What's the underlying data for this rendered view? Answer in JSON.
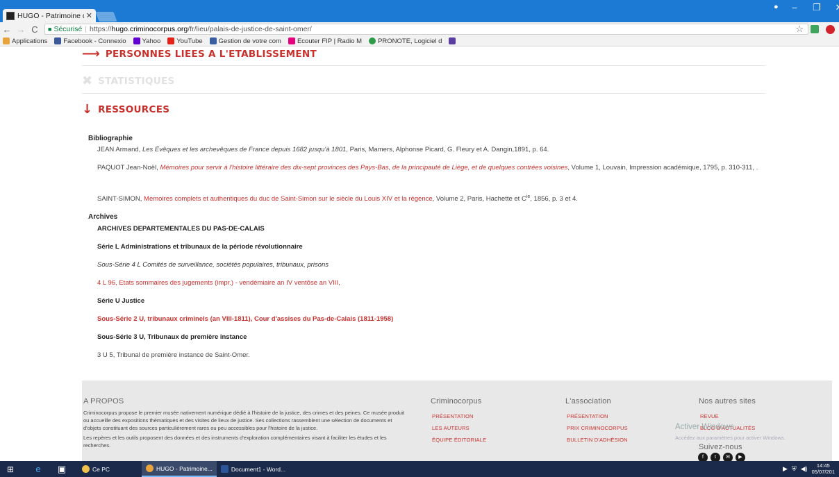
{
  "browser": {
    "tab_title": "HUGO - Patrimoine des...",
    "secure_label": "Sécurisé",
    "url_prefix": "https://",
    "url_domain": "hugo.criminocorpus.org",
    "url_path": "/fr/lieu/palais-de-justice-de-saint-omer/",
    "bookmarks": [
      {
        "label": "Applications",
        "color": "#e8a33d"
      },
      {
        "label": "Facebook - Connexio",
        "color": "#3b5998"
      },
      {
        "label": "Yahoo",
        "color": "#6001d2"
      },
      {
        "label": "YouTube",
        "color": "#e62117"
      },
      {
        "label": "Gestion de votre com",
        "color": "#3a5fa0"
      },
      {
        "label": "Ecouter FIP | Radio M",
        "color": "#e6007e"
      },
      {
        "label": "PRONOTE, Logiciel d",
        "color": "#2d9b4a"
      }
    ]
  },
  "sections": {
    "personnes": "PERSONNES LIEES A L'ETABLISSEMENT",
    "statistiques": "STATISTIQUES",
    "ressources": "RESSOURCES"
  },
  "bibliographie": {
    "title": "Bibliographie",
    "entry1_author": "JEAN Armand, ",
    "entry1_title": "Les Évêques et les archevêques de France depuis 1682 jusqu'à 1801",
    "entry1_rest": ", Paris, Mamers, Alphonse Picard, G. Fleury et A. Dangin,1891, p. 64.",
    "entry2_author": "PAQUOT Jean-Noël, ",
    "entry2_title": "Mémoires pour servir à l'histoire littéraire des dix-sept provinces des Pays-Bas, de la principauté de Liège, et de quelques contrées voisines",
    "entry2_rest": ", Volume 1, Louvain, Impression académique, 1795, p. 310-311, .",
    "entry3_author": "SAINT-SIMON, ",
    "entry3_title": "Memoires complets et authentiques du duc de Saint-Simon sur le siècle du Louis XIV et la régence",
    "entry3_rest": ", Volume 2, Paris, Hachette et C",
    "entry3_sup": "ie",
    "entry3_end": ", 1856, p. 3 et 4."
  },
  "archives": {
    "title": "Archives",
    "depot": "ARCHIVES DEPARTEMENTALES DU PAS-DE-CALAIS",
    "serie_l": "Série L Administrations et tribunaux de la période révolutionnaire",
    "sous_serie_4l": "Sous-Série 4 L Comités de surveillance, sociétés populaires, tribunaux, prisons",
    "cote_4l96": "4 L 96, Etats sommaires des jugements (impr.) - vendémiaire an IV ventôse an VIII,",
    "serie_u": "Série U Justice",
    "sous_serie_2u": "Sous-Série 2 U, tribunaux criminels (an VIII-1811), Cour d'assises du Pas-de-Calais (1811-1958)",
    "sous_serie_3u": "Sous-Série 3 U, Tribunaux de première instance",
    "cote_3u5": "3 U 5, Tribunal de première instance de Saint-Omer."
  },
  "footer": {
    "apropos_title": "A PROPOS",
    "apropos_text1": "Criminocorpus propose le premier musée nativement numérique dédié à l'histoire de la justice, des crimes et des peines. Ce musée produit ou accueille des expositions thématiques et des visites de lieux de justice. Ses collections rassemblent une sélection de documents et d'objets constituant des sources particulièrement rares ou peu accessibles pour l'histoire de la justice.",
    "apropos_text2": "Les repères et les outils proposent des données et des instruments d'exploration complémentaires visant à faciliter les études et les recherches.",
    "criminocorpus_title": "Criminocorpus",
    "criminocorpus_links": [
      "PRÉSENTATION",
      "LES AUTEURS",
      "ÉQUIPE ÉDITORIALE"
    ],
    "association_title": "L'association",
    "association_links": [
      "PRÉSENTATION",
      "PRIX CRIMINOCORPUS",
      "BULLETIN D'ADHÉSION"
    ],
    "autres_title": "Nos autres sites",
    "autres_links": [
      "REVUE",
      "BLOG D'ACTUALITÉS"
    ],
    "suivez": "Suivez-nous",
    "activate_title": "Activer Windows",
    "activate_text": "Accédez aux paramètres pour activer Windows."
  },
  "taskbar": {
    "apps": [
      {
        "label": "Ce PC",
        "color": "#f0c24b",
        "active": false
      },
      {
        "label": "HUGO - Patrimoine...",
        "color": "#e8a33d",
        "active": true
      },
      {
        "label": "Document1 - Word...",
        "color": "#2b579a",
        "active": false
      }
    ],
    "time": "14:45",
    "date": "05/07/201"
  }
}
